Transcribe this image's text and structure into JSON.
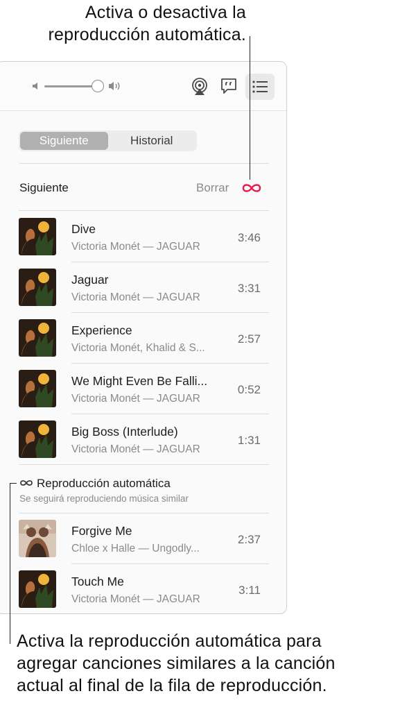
{
  "callouts": {
    "top_line1": "Activa o desactiva la",
    "top_line2": "reproducción automática.",
    "bottom_line1": "Activa la reproducción automática para",
    "bottom_line2": "agregar canciones similares a la canción",
    "bottom_line3": "actual al final de la fila de reproducción."
  },
  "toolbar": {
    "icons": [
      "volume-low-icon",
      "volume-slider",
      "volume-high-icon",
      "airplay-icon",
      "lyrics-icon",
      "queue-icon"
    ],
    "volume_level": 0.85
  },
  "segmented": {
    "tabs": [
      {
        "label": "Siguiente",
        "active": true
      },
      {
        "label": "Historial",
        "active": false
      }
    ]
  },
  "up_next": {
    "label": "Siguiente",
    "clear_label": "Borrar",
    "autoplay_icon": "infinity-icon"
  },
  "tracks": [
    {
      "title": "Dive",
      "artist": "Victoria Monét — JAGUAR",
      "duration": "3:46",
      "art": "jaguar-cover"
    },
    {
      "title": "Jaguar",
      "artist": "Victoria Monét — JAGUAR",
      "duration": "3:31",
      "art": "jaguar-cover"
    },
    {
      "title": "Experience",
      "artist": "Victoria Monét, Khalid & S...",
      "duration": "2:57",
      "art": "jaguar-cover"
    },
    {
      "title": "We Might Even Be Falli...",
      "artist": "Victoria Monét — JAGUAR",
      "duration": "0:52",
      "art": "jaguar-cover"
    },
    {
      "title": "Big Boss (Interlude)",
      "artist": "Victoria Monét — JAGUAR",
      "duration": "1:31",
      "art": "jaguar-cover"
    }
  ],
  "autoplay": {
    "title": "Reproducción automática",
    "subtitle": "Se seguirá reproduciendo música similar"
  },
  "autoplay_tracks": [
    {
      "title": "Forgive Me",
      "artist": "Chloe x Halle — Ungodly...",
      "duration": "2:37",
      "art": "ungodly-hour-cover"
    },
    {
      "title": "Touch Me",
      "artist": "Victoria Monét — JAGUAR",
      "duration": "3:11",
      "art": "jaguar-cover"
    }
  ],
  "colors": {
    "accent_red": "#e8194a",
    "segment_active": "#b0b0b0"
  }
}
